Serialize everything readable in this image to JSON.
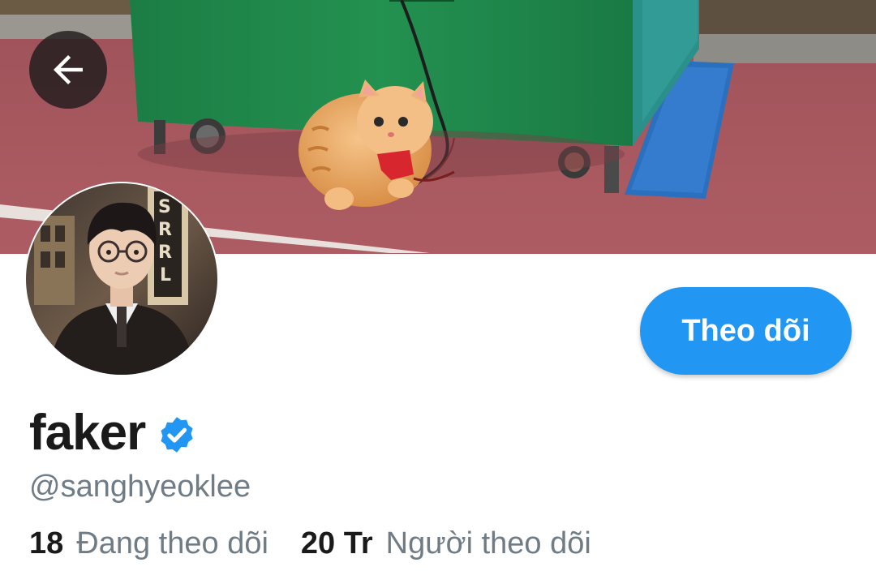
{
  "header": {
    "back_icon": "arrow-left-icon",
    "banner_image": "orange-cat-on-pavement"
  },
  "profile": {
    "display_name": "faker",
    "verified_icon": "verified-badge-icon",
    "handle": "@sanghyeoklee",
    "follow_label": "Theo dõi"
  },
  "stats": {
    "following_count": "18",
    "following_label": "Đang theo dõi",
    "followers_count": "20 Tr",
    "followers_label": "Người theo dõi"
  },
  "colors": {
    "accent": "#2196f3",
    "text_primary": "#1a1a1a",
    "text_secondary": "#6f7b85"
  }
}
